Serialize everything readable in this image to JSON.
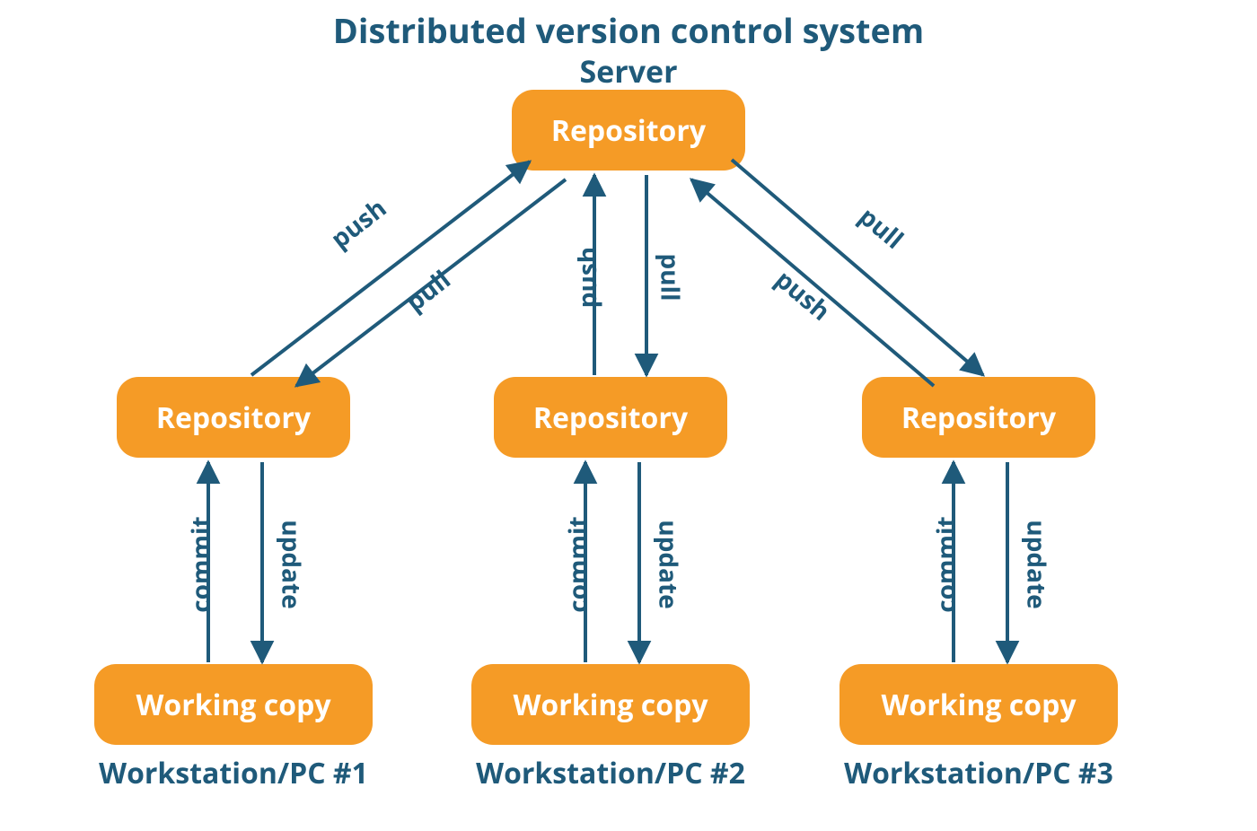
{
  "title": "Distributed version control system",
  "server_label": "Server",
  "nodes": {
    "server_repo": "Repository",
    "repo1": "Repository",
    "repo2": "Repository",
    "repo3": "Repository",
    "wc1": "Working copy",
    "wc2": "Working copy",
    "wc3": "Working copy"
  },
  "workstation_labels": [
    "Workstation/PC #1",
    "Workstation/PC #2",
    "Workstation/PC #3"
  ],
  "edge_labels": {
    "push": "push",
    "pull": "pull",
    "commit": "commit",
    "update": "update"
  },
  "colors": {
    "node_fill": "#f59b26",
    "node_text": "#ffffff",
    "accent": "#1f5a7a",
    "arrow": "#1f5a7a"
  }
}
